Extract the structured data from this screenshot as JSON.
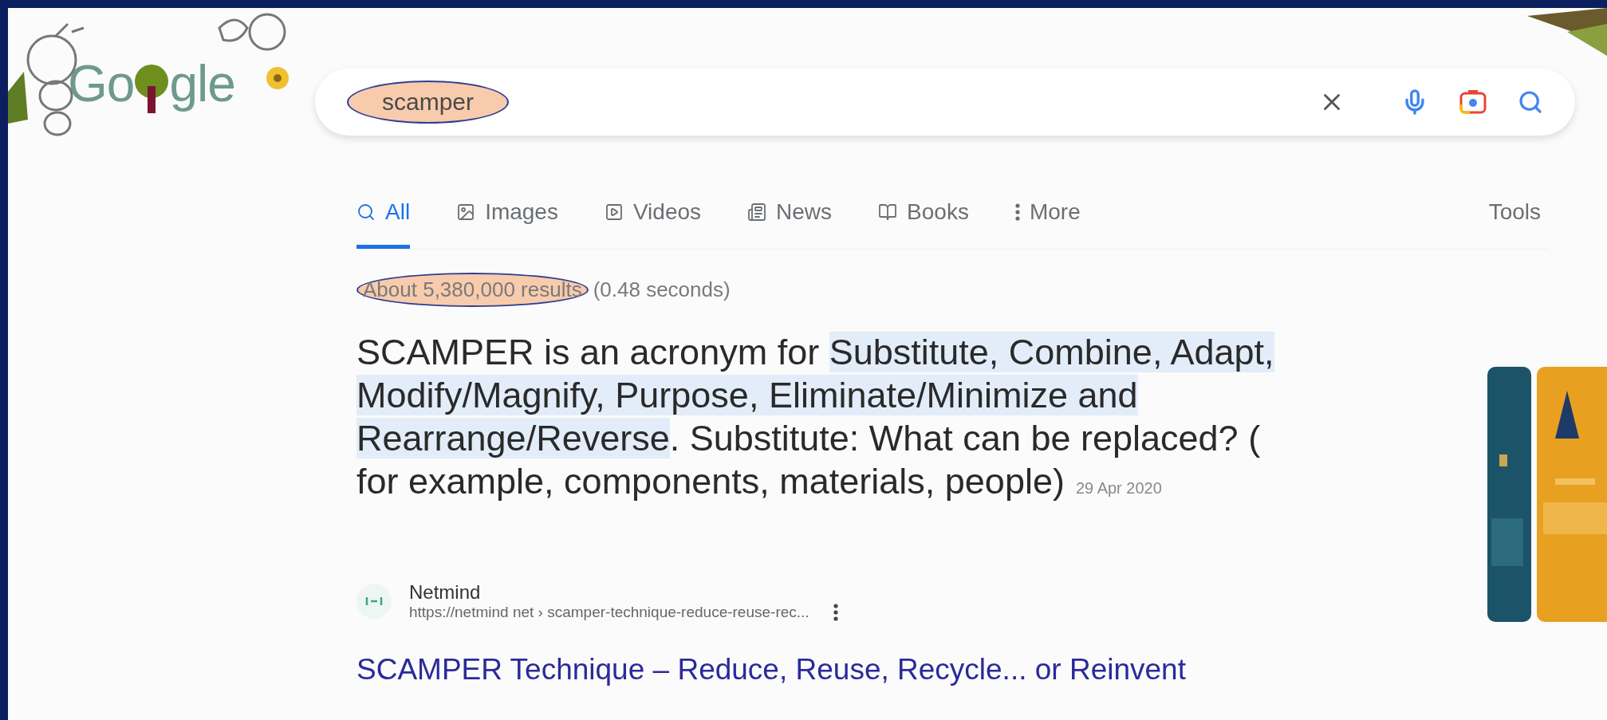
{
  "logo": {
    "before": "Go",
    "after": "gle"
  },
  "search": {
    "value": "scamper",
    "annotated": true
  },
  "tabs": [
    {
      "label": "All",
      "kind": "all",
      "selected": true
    },
    {
      "label": "Images",
      "kind": "images",
      "selected": false
    },
    {
      "label": "Videos",
      "kind": "videos",
      "selected": false
    },
    {
      "label": "News",
      "kind": "news",
      "selected": false
    },
    {
      "label": "Books",
      "kind": "books",
      "selected": false
    },
    {
      "label": "More",
      "kind": "more",
      "selected": false
    }
  ],
  "tools": "Tools",
  "results_count": {
    "text": "About 5,380,000 results",
    "annotated": true,
    "time": "(0.48 seconds)"
  },
  "featured_snippet": {
    "segments": [
      {
        "text": "SCAMPER is an acronym for ",
        "highlighted": false
      },
      {
        "text": "Substitute, Combine, Adapt, Modify/Magnify, Purpose, Eliminate/Minimize and Rearrange/Reverse",
        "highlighted": true
      },
      {
        "text": ". Substitute: What can be replaced? ( for example, components, materials, people)",
        "highlighted": false
      }
    ],
    "date": "29 Apr 2020"
  },
  "result": {
    "site": "Netmind",
    "url": "https://netmind net › scamper-technique-reduce-reuse-rec...",
    "title": "SCAMPER Technique – Reduce, Reuse, Recycle... or Reinvent"
  }
}
